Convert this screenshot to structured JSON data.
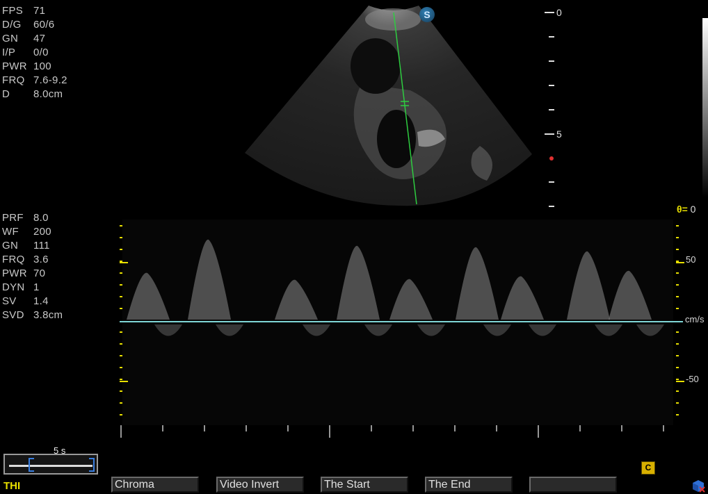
{
  "bmode_params": [
    {
      "key": "FPS",
      "value": "71"
    },
    {
      "key": "D/G",
      "value": "60/6"
    },
    {
      "key": "GN",
      "value": "47"
    },
    {
      "key": "I/P",
      "value": "0/0"
    },
    {
      "key": "PWR",
      "value": "100"
    },
    {
      "key": "FRQ",
      "value": "7.6-9.2"
    },
    {
      "key": "D",
      "value": "8.0cm"
    }
  ],
  "doppler_params": [
    {
      "key": "PRF",
      "value": "8.0"
    },
    {
      "key": "WF",
      "value": "200"
    },
    {
      "key": "GN",
      "value": "111"
    },
    {
      "key": "FRQ",
      "value": "3.6"
    },
    {
      "key": "PWR",
      "value": "70"
    },
    {
      "key": "DYN",
      "value": "1"
    },
    {
      "key": "SV",
      "value": "1.4"
    },
    {
      "key": "SVD",
      "value": "3.8cm"
    }
  ],
  "depth_scale": {
    "labels": [
      "0",
      "5"
    ]
  },
  "probe_marker": "S",
  "theta": {
    "label": "θ=",
    "value": "0"
  },
  "velocity_scale": {
    "pos_label": "50",
    "neg_label": "-50",
    "units": "cm/s"
  },
  "time_scale": {
    "label": "5 s"
  },
  "mode_label": "THI",
  "softkeys": [
    {
      "label": "Chroma"
    },
    {
      "label": "Video Invert"
    },
    {
      "label": "The Start"
    },
    {
      "label": "The End"
    },
    {
      "label": ""
    }
  ],
  "cine_icon": "C",
  "colors": {
    "baseline": "#7fd6d6",
    "scale_yellow": "#e8e000",
    "cursor_green": "#2ecc40",
    "softkey_bg": "#2a2a2a"
  },
  "icons": [
    "s-probe-icon",
    "cine-c-icon",
    "cube-icon"
  ]
}
